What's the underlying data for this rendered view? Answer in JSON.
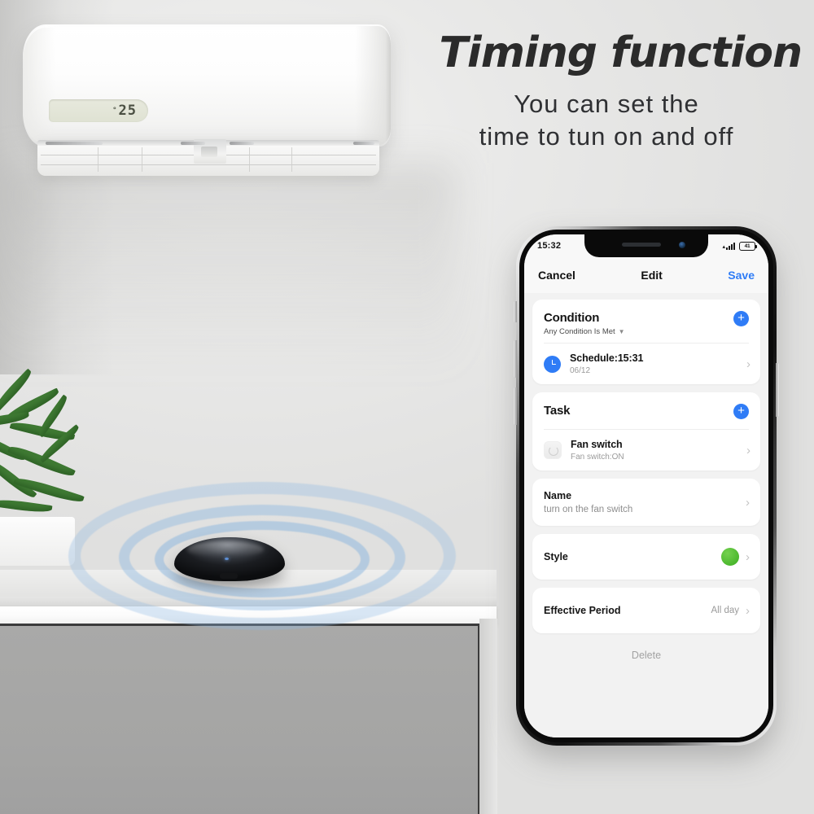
{
  "promo": {
    "headline": "Timing function",
    "subheadline_line1": "You can set the",
    "subheadline_line2": "time to tun on and off"
  },
  "appliance": {
    "name": "air-conditioner",
    "display_degree": "°",
    "display_temperature": "25"
  },
  "device": {
    "name": "ir-blaster",
    "signal_rings": 3
  },
  "phone": {
    "status_bar": {
      "time": "15:32",
      "signal_icon": "cellular-signal-icon",
      "battery_icon": "battery-icon",
      "battery_level": "41"
    },
    "nav": {
      "cancel_label": "Cancel",
      "title": "Edit",
      "save_label": "Save",
      "save_color": "#2f7cf6"
    },
    "condition_card": {
      "title": "Condition",
      "subtitle": "Any Condition Is Met",
      "add_label": "+",
      "items": [
        {
          "icon": "clock-icon",
          "title": "Schedule:15:31",
          "subtitle": "06/12",
          "chevron": "›"
        }
      ]
    },
    "task_card": {
      "title": "Task",
      "add_label": "+",
      "items": [
        {
          "icon": "fan-switch-icon",
          "title": "Fan switch",
          "subtitle": "Fan switch:ON",
          "chevron": "›"
        }
      ]
    },
    "settings_rows": [
      {
        "label": "Name",
        "sub_value": "turn on the fan switch",
        "value": "",
        "swatch": "",
        "chevron": "›"
      },
      {
        "label": "Style",
        "sub_value": "",
        "value": "",
        "swatch": "#4cb82e",
        "chevron": "›"
      },
      {
        "label": "Effective Period",
        "sub_value": "",
        "value": "All day",
        "swatch": "",
        "chevron": "›"
      }
    ],
    "delete_label": "Delete"
  }
}
